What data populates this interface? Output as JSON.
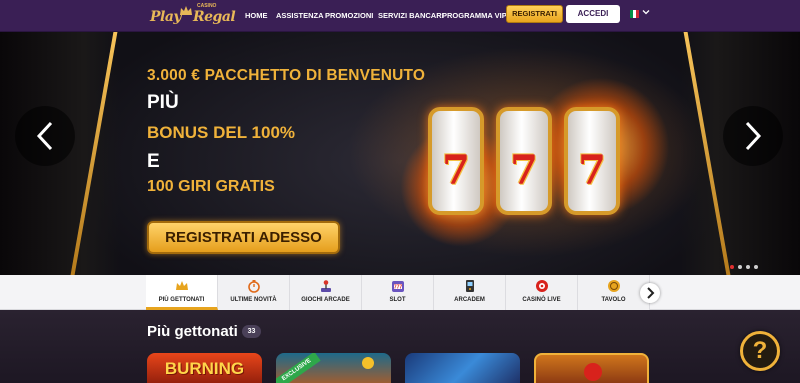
{
  "header": {
    "logo": {
      "play": "Play",
      "casino": "CASINO",
      "regal": "Regal"
    },
    "nav": [
      "HOME",
      "ASSISTENZA",
      "PROMOZIONI",
      "SERVIZI BANCARI",
      "PROGRAMMA VIP"
    ],
    "register_label": "REGISTRATI",
    "login_label": "ACCEDI",
    "language_flag": [
      "#009246",
      "#ffffff",
      "#ce2b37"
    ]
  },
  "hero": {
    "line1": "3.000 € PACCHETTO DI BENVENUTO",
    "line2": "PIÙ",
    "line3": "BONUS DEL 100%",
    "line4": "E",
    "line5": "100 GIRI GRATIS",
    "cta_label": "REGISTRATI ADESSO",
    "reel_symbols": [
      "7",
      "7",
      "7"
    ],
    "slides": 4,
    "active_slide": 1
  },
  "categories": [
    {
      "label": "PIÙ GETTONATI",
      "icon": "crown-icon",
      "active": true
    },
    {
      "label": "ULTIME NOVITÀ",
      "icon": "stopwatch-icon",
      "active": false
    },
    {
      "label": "GIOCHI ARCADE",
      "icon": "joystick-icon",
      "active": false
    },
    {
      "label": "SLOT",
      "icon": "slot-icon",
      "active": false
    },
    {
      "label": "ARCADEM",
      "icon": "arcade-machine-icon",
      "active": false
    },
    {
      "label": "CASINÒ LIVE",
      "icon": "roulette-chip-icon",
      "active": false
    },
    {
      "label": "TAVOLO",
      "icon": "table-chip-icon",
      "active": false
    }
  ],
  "games": {
    "title": "Più gettonati",
    "count": "33",
    "tiles": [
      {
        "label": "BURNING",
        "badge": ""
      },
      {
        "label": "",
        "badge": "EXCLUSIVE"
      },
      {
        "label": "",
        "badge": ""
      },
      {
        "label": "",
        "badge": ""
      }
    ]
  },
  "help_label": "?",
  "colors": {
    "header": "#3a1f55",
    "accent": "#f0b23a",
    "cta": "#e9a51e"
  }
}
